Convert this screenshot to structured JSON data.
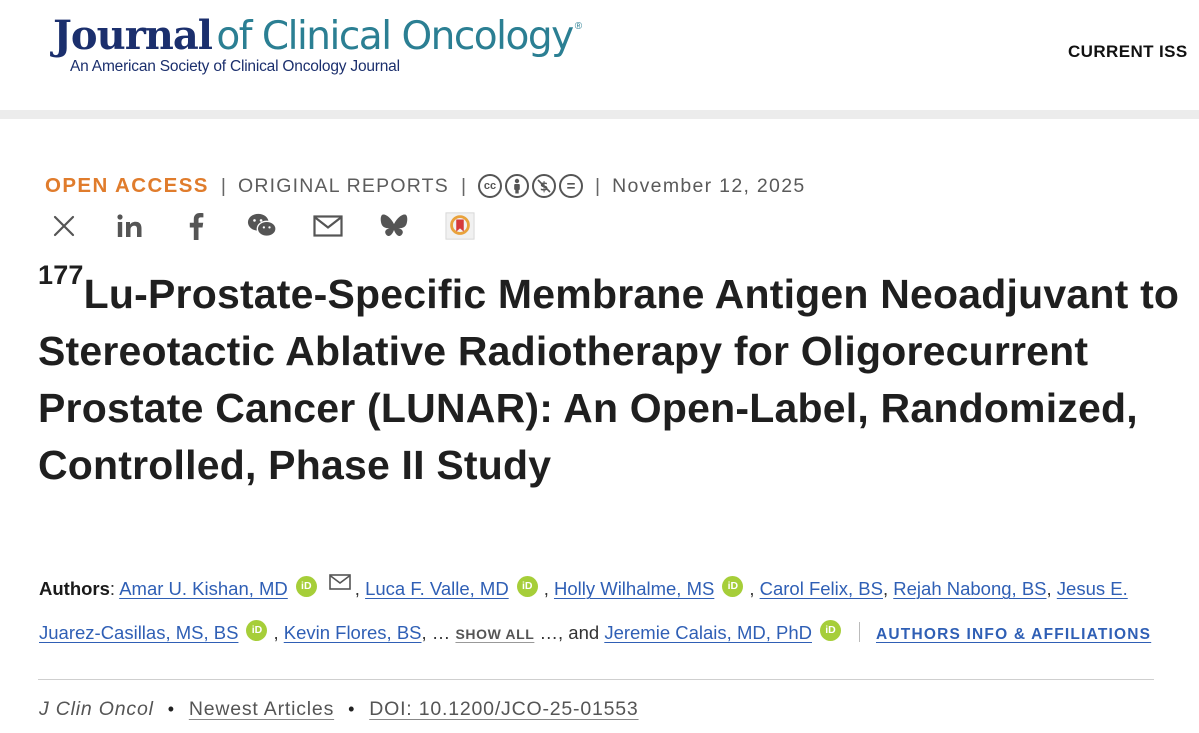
{
  "header": {
    "logo_journal": "Journal",
    "logo_rest": "of Clinical Oncology",
    "logo_reg": "®",
    "logo_subtitle": "An American Society of Clinical Oncology Journal",
    "nav_current": "CURRENT ISS"
  },
  "meta": {
    "open_access": "OPEN ACCESS",
    "separator": "|",
    "article_type": "ORIGINAL REPORTS",
    "license_icons": [
      "cc-icon",
      "by-icon",
      "nc-icon",
      "nd-icon"
    ],
    "license_glyphs": {
      "cc": "cc",
      "nd": "="
    },
    "date": "November 12, 2025"
  },
  "share": {
    "icons": [
      "x-icon",
      "linkedin-icon",
      "facebook-icon",
      "wechat-icon",
      "email-icon",
      "bluesky-icon",
      "bookmark-icon"
    ]
  },
  "article": {
    "title_sup": "177",
    "title": "Lu-Prostate-Specific Membrane Antigen Neoadjuvant to Stereotactic Ablative Radiotherapy for Oligorecurrent Prostate Cancer (LUNAR): An Open-Label, Randomized, Controlled, Phase II Study"
  },
  "authors": {
    "label": "Authors",
    "colon": ":",
    "comma": ",",
    "orcid_glyph": "iD",
    "list": [
      {
        "name": "Amar U. Kishan, MD"
      },
      {
        "name": "Luca F. Valle, MD"
      },
      {
        "name": "Holly Wilhalme, MS"
      },
      {
        "name": "Carol Felix, BS"
      },
      {
        "name": "Rejah Nabong, BS"
      },
      {
        "name": "Jesus E. Juarez-Casillas, MS, BS"
      },
      {
        "name": "Kevin Flores, BS"
      },
      {
        "name": "Jeremie Calais, MD, PhD"
      }
    ],
    "ellipsis": "…",
    "show_all": "SHOW ALL",
    "and_text": ", and",
    "info_affiliations": "AUTHORS INFO & AFFILIATIONS"
  },
  "citation": {
    "journal": "J Clin Oncol",
    "bullet": "•",
    "section": "Newest Articles",
    "doi": "DOI: 10.1200/JCO-25-01553"
  },
  "colors": {
    "open_access": "#e07c2c",
    "brand_navy": "#1b2f6d",
    "brand_teal": "#2b7f93",
    "link": "#2f5fb5",
    "orcid": "#a6ce39"
  }
}
